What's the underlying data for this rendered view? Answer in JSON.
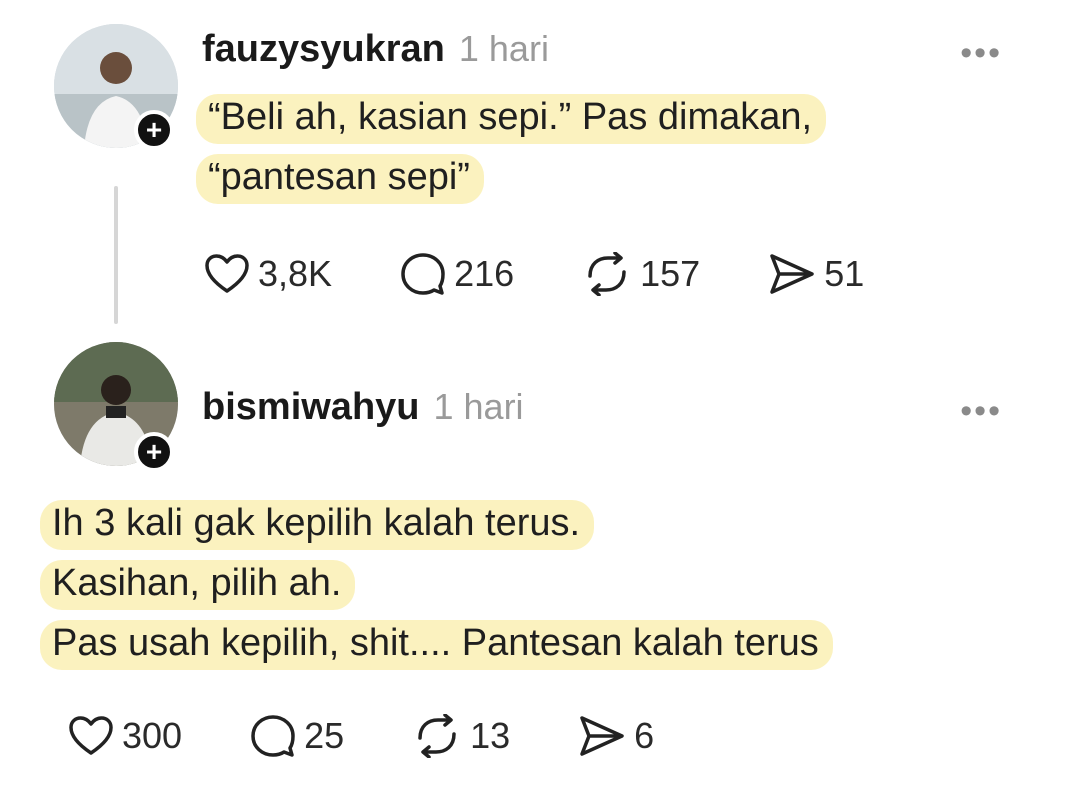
{
  "posts": [
    {
      "username": "fauzysyukran",
      "time": "1 hari",
      "more": "•••",
      "lines": [
        "“Beli ah, kasian sepi.” Pas dimakan,",
        "“pantesan sepi”"
      ],
      "likes": "3,8K",
      "replies": "216",
      "reposts": "157",
      "shares": "51"
    },
    {
      "username": "bismiwahyu",
      "time": "1 hari",
      "more": "•••",
      "lines": [
        "Ih 3 kali gak kepilih kalah terus.",
        "Kasihan, pilih ah.",
        "Pas usah kepilih, shit.... Pantesan kalah terus"
      ],
      "likes": "300",
      "replies": "25",
      "reposts": "13",
      "shares": "6"
    }
  ],
  "follow_badge": "+",
  "colors": {
    "highlight": "#fbf2bf",
    "text": "#1a1a1a",
    "muted": "#9a9a9a"
  },
  "icons": [
    "heart-icon",
    "comment-icon",
    "repost-icon",
    "share-icon",
    "more-icon",
    "plus-icon"
  ]
}
